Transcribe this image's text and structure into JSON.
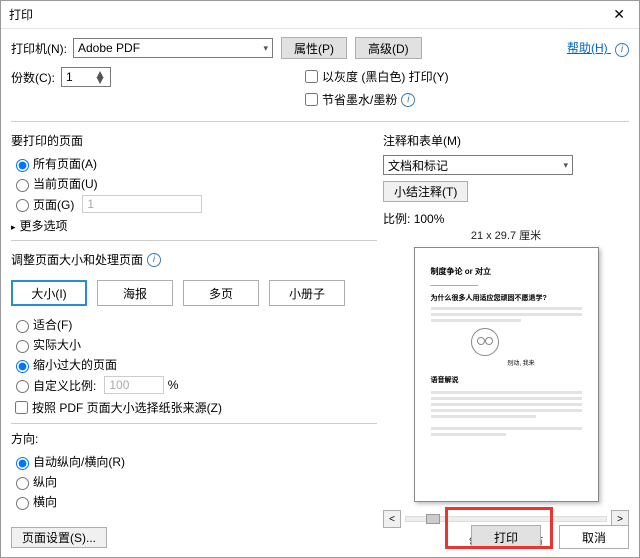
{
  "window": {
    "title": "打印"
  },
  "help": "帮助(H)",
  "printer": {
    "label": "打印机(N):",
    "selected": "Adobe PDF",
    "properties": "属性(P)",
    "advanced": "高级(D)"
  },
  "copies": {
    "label": "份数(C):",
    "value": "1"
  },
  "options": {
    "grayscale": "以灰度 (黑白色) 打印(Y)",
    "saveink": "节省墨水/墨粉"
  },
  "pages": {
    "title": "要打印的页面",
    "all": "所有页面(A)",
    "current": "当前页面(U)",
    "range": "页面(G)",
    "range_value": "1",
    "more": "更多选项"
  },
  "scaling": {
    "title": "调整页面大小和处理页面",
    "tabs": {
      "size": "大小(I)",
      "poster": "海报",
      "multi": "多页",
      "booklet": "小册子"
    },
    "fit": "适合(F)",
    "actual": "实际大小",
    "shrink": "缩小过大的页面",
    "custom": "自定义比例:",
    "custom_value": "100",
    "pct": "%",
    "paper_source": "按照 PDF 页面大小选择纸张来源(Z)"
  },
  "orientation": {
    "title": "方向:",
    "auto": "自动纵向/横向(R)",
    "portrait": "纵向",
    "landscape": "横向"
  },
  "comments": {
    "title": "注释和表单(M)",
    "selected": "文档和标记",
    "summarize": "小结注释(T)",
    "scale_label": "比例:",
    "scale_value": "100%",
    "dim": "21 x 29.7 厘米"
  },
  "preview": {
    "h1": "制度争论 or 对立",
    "h2": "为什么很多人用适应您顽固不愿退学?",
    "hand": "别动, 我来"
  },
  "pager": "第 1 页, 共 1 页",
  "footer": {
    "page_setup": "页面设置(S)...",
    "print": "打印",
    "cancel": "取消"
  }
}
